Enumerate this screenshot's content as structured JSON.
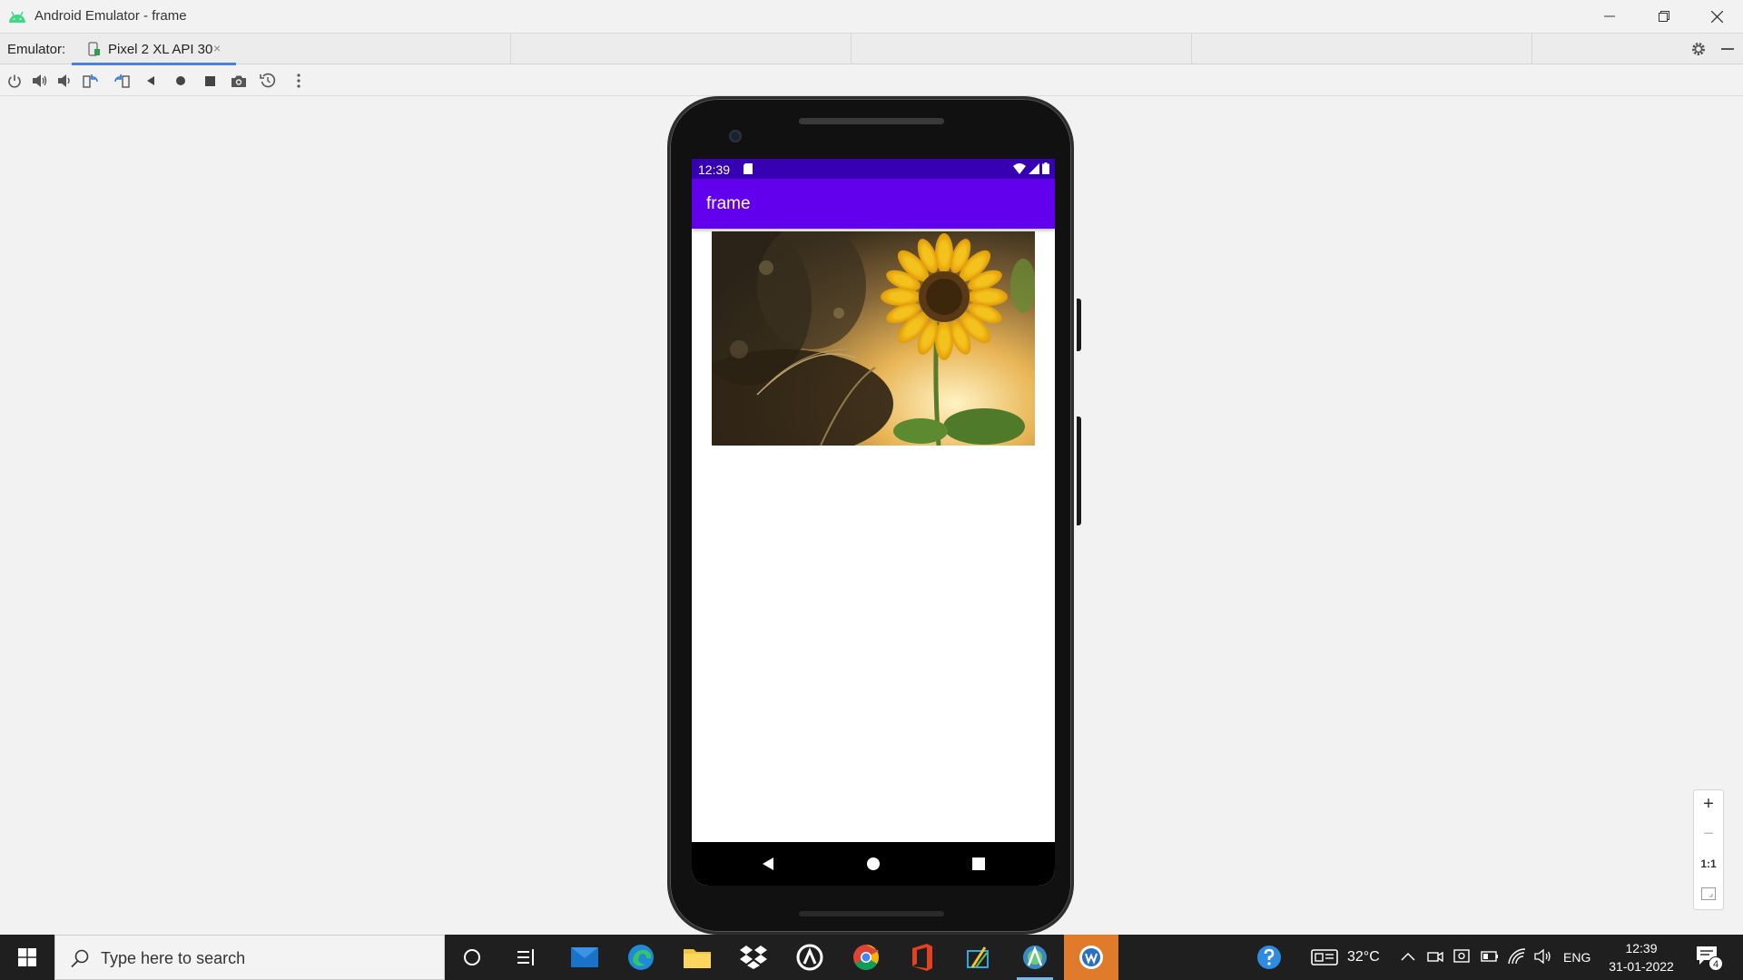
{
  "window": {
    "title": "Android Emulator - frame",
    "accent": "#4a80d6"
  },
  "tabs": {
    "label": "Emulator:",
    "active_tab": "Pixel 2 XL API 30",
    "close_glyph": "×"
  },
  "toolbar": {
    "icons": [
      "power-icon",
      "volume-up-icon",
      "volume-down-icon",
      "rotate-left-icon",
      "rotate-right-icon",
      "back-icon",
      "home-icon",
      "overview-icon",
      "screenshot-icon",
      "snapshot-icon",
      "more-icon"
    ]
  },
  "device": {
    "status_time": "12:39",
    "app_title": "frame",
    "status_bar_color": "#3700b3",
    "app_bar_color": "#6200ee"
  },
  "zoom": {
    "plus": "+",
    "minus": "−",
    "one_to_one": "1:1"
  },
  "taskbar": {
    "search_placeholder": "Type here to search",
    "temperature": "32°C",
    "language": "ENG",
    "time": "12:39",
    "date": "31-01-2022",
    "notification_count": "4"
  }
}
